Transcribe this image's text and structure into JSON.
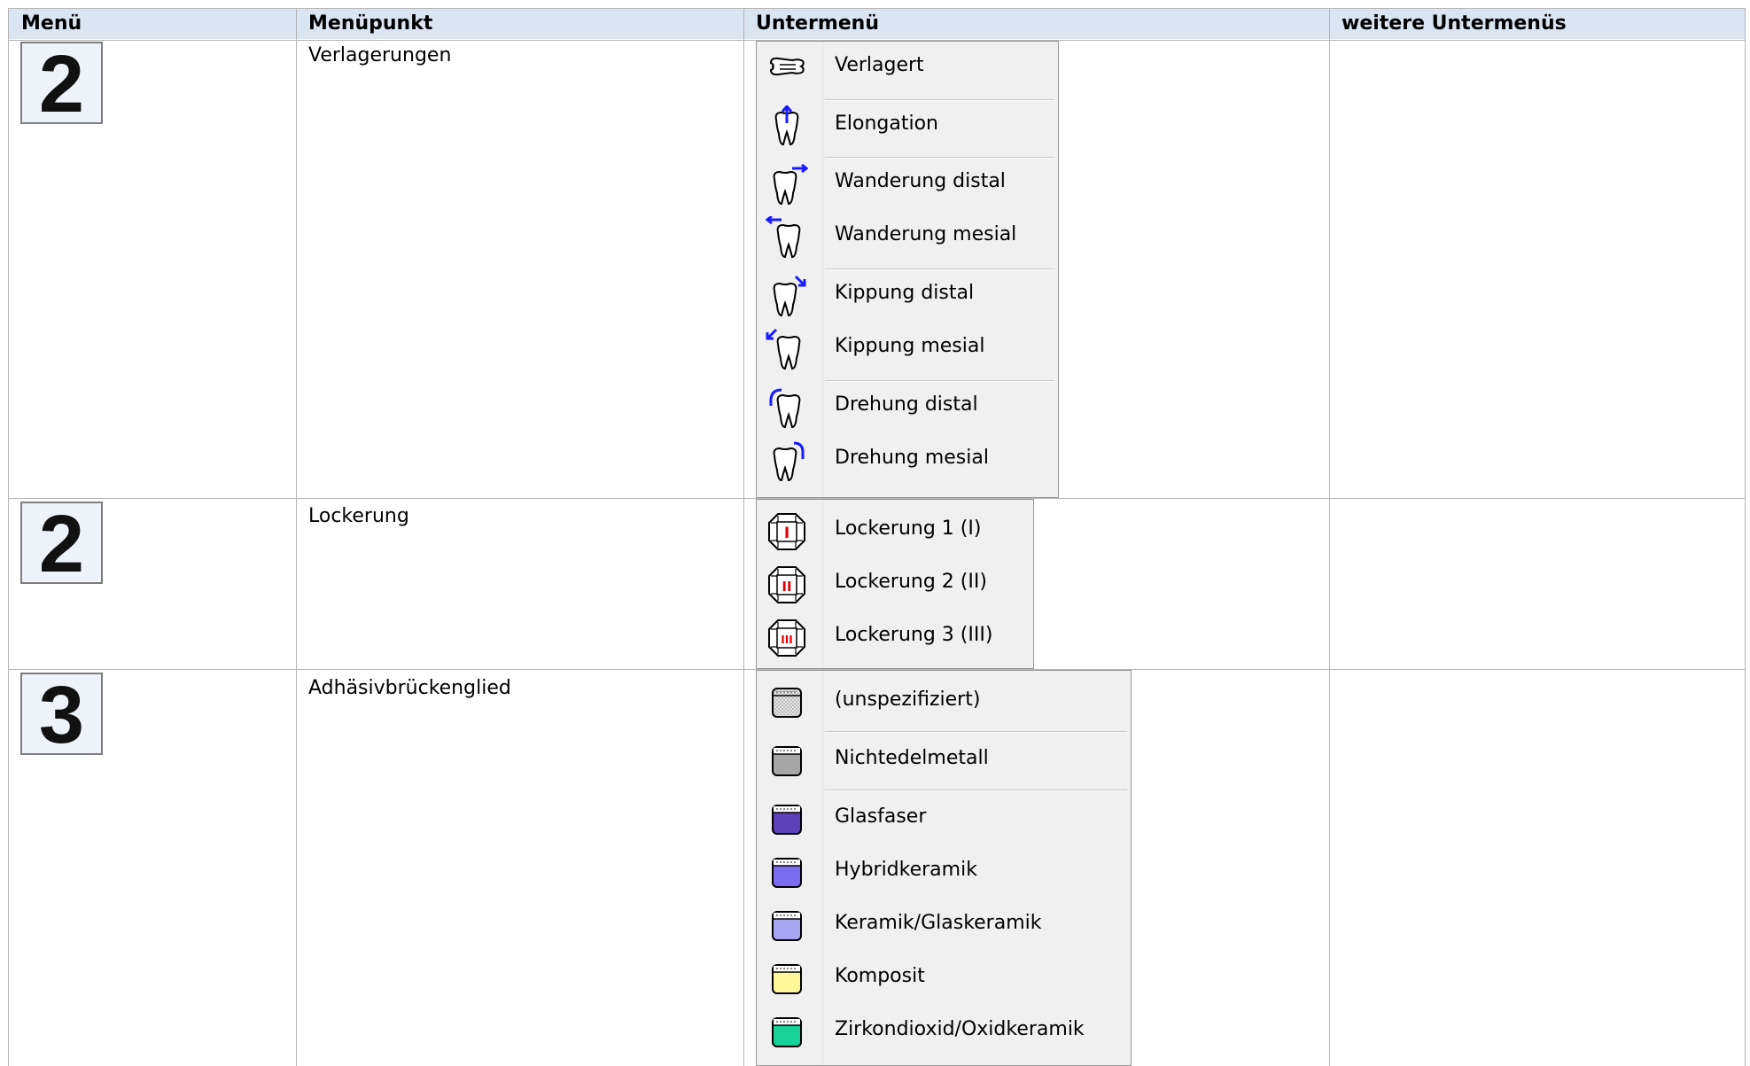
{
  "headers": [
    "Menü",
    "Menüpunkt",
    "Untermenü",
    "weitere Untermenüs"
  ],
  "rows": [
    {
      "menu_number": "2",
      "menu_item": "Verlagerungen",
      "submenu": [
        {
          "label": "Verlagert",
          "icon": "tooth-sideways-icon"
        },
        {
          "label": "Elongation",
          "icon": "tooth-elongation-icon"
        },
        {
          "label": "Wanderung distal",
          "icon": "tooth-drift-distal-icon"
        },
        {
          "label": "Wanderung mesial",
          "icon": "tooth-drift-mesial-icon"
        },
        {
          "label": "Kippung distal",
          "icon": "tooth-tilt-distal-icon"
        },
        {
          "label": "Kippung mesial",
          "icon": "tooth-tilt-mesial-icon"
        },
        {
          "label": "Drehung distal",
          "icon": "tooth-rotation-distal-icon"
        },
        {
          "label": "Drehung mesial",
          "icon": "tooth-rotation-mesial-icon"
        }
      ]
    },
    {
      "menu_number": "2",
      "menu_item": "Lockerung",
      "submenu": [
        {
          "label": "Lockerung 1 (I)",
          "icon": "mobility-1-icon",
          "badge": "I"
        },
        {
          "label": "Lockerung 2 (II)",
          "icon": "mobility-2-icon",
          "badge": "II"
        },
        {
          "label": "Lockerung 3 (III)",
          "icon": "mobility-3-icon",
          "badge": "III"
        }
      ]
    },
    {
      "menu_number": "3",
      "menu_item": "Adhäsivbrückenglied",
      "submenu": [
        {
          "label": "(unspezifiziert)",
          "icon": "material-unspecified-icon",
          "color": "#d0d0d0"
        },
        {
          "label": "Nichtedelmetall",
          "icon": "material-nonprecious-metal-icon",
          "color": "#a6a6a6"
        },
        {
          "label": "Glasfaser",
          "icon": "material-glass-fiber-icon",
          "color": "#5a3fb8"
        },
        {
          "label": "Hybridkeramik",
          "icon": "material-hybrid-ceramic-icon",
          "color": "#7b6cf0"
        },
        {
          "label": "Keramik/Glaskeramik",
          "icon": "material-ceramic-icon",
          "color": "#a8a6f2"
        },
        {
          "label": "Komposit",
          "icon": "material-composite-icon",
          "color": "#fff79a"
        },
        {
          "label": "Zirkondioxid/Oxidkeramik",
          "icon": "material-zirconia-icon",
          "color": "#17d196"
        }
      ]
    }
  ],
  "accent_colors": {
    "header_bg": "#dbe5f1",
    "arrow_blue": "#1a1aff",
    "badge_red": "#e00000"
  }
}
